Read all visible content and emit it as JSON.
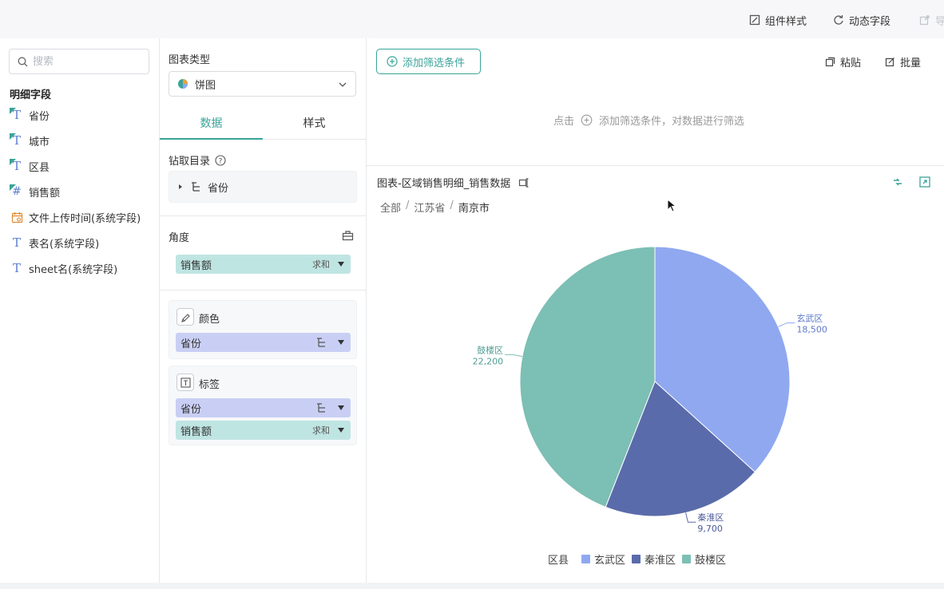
{
  "toolbar": {
    "component_style": "组件样式",
    "dynamic_field": "动态字段",
    "export_partial": "导"
  },
  "left": {
    "search_placeholder": "搜索",
    "section_title": "明细字段",
    "fields": [
      {
        "label": "省份",
        "type": "dim-text"
      },
      {
        "label": "城市",
        "type": "dim-text"
      },
      {
        "label": "区县",
        "type": "dim-text"
      },
      {
        "label": "销售额",
        "type": "measure"
      },
      {
        "label": "文件上传时间(系统字段)",
        "type": "date"
      },
      {
        "label": "表名(系统字段)",
        "type": "text"
      },
      {
        "label": "sheet名(系统字段)",
        "type": "text"
      }
    ]
  },
  "config": {
    "chart_type_label": "图表类型",
    "chart_type_value": "饼图",
    "tabs": [
      "数据",
      "样式"
    ],
    "drill_label": "钻取目录",
    "drill_item": "省份",
    "angle_label": "角度",
    "angle_pill": {
      "label": "销售额",
      "agg": "求和"
    },
    "color_label": "颜色",
    "color_pill": {
      "label": "省份"
    },
    "tag_label": "标签",
    "tag_pills": [
      {
        "label": "省份"
      },
      {
        "label": "销售额",
        "agg": "求和"
      }
    ]
  },
  "filter": {
    "add_button": "添加筛选条件",
    "paste": "粘贴",
    "batch": "批量",
    "hint_prefix": "点击",
    "hint_suffix": "添加筛选条件，对数据进行筛选"
  },
  "chart_header": {
    "title": "图表-区域销售明细_销售数据",
    "breadcrumb": [
      "全部",
      "江苏省",
      "南京市"
    ]
  },
  "chart_data": {
    "type": "pie",
    "legend_title": "区县",
    "legend_position": "bottom",
    "categories": [
      "玄武区",
      "秦淮区",
      "鼓楼区"
    ],
    "values": [
      18500,
      9700,
      22200
    ],
    "value_labels": [
      "18,500",
      "9,700",
      "22,200"
    ],
    "colors": [
      "#8fa8f0",
      "#5a6bab",
      "#7cbfb4"
    ]
  },
  "colors": {
    "accent": "#3aa39a"
  }
}
